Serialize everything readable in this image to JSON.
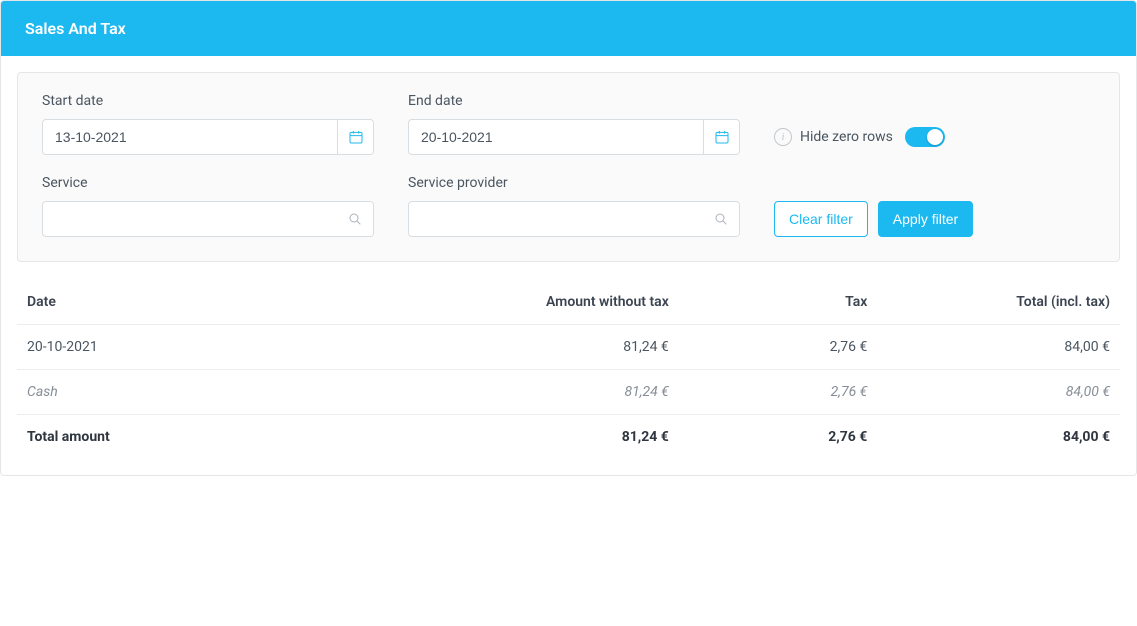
{
  "header": {
    "title": "Sales And Tax"
  },
  "filters": {
    "start_date": {
      "label": "Start date",
      "value": "13-10-2021"
    },
    "end_date": {
      "label": "End date",
      "value": "20-10-2021"
    },
    "service": {
      "label": "Service",
      "value": ""
    },
    "provider": {
      "label": "Service provider",
      "value": ""
    },
    "hide_zero": {
      "label": "Hide zero rows",
      "on": true
    },
    "clear_button": "Clear filter",
    "apply_button": "Apply filter"
  },
  "table": {
    "columns": {
      "date": "Date",
      "amount": "Amount without tax",
      "tax": "Tax",
      "total": "Total (incl. tax)"
    },
    "rows": [
      {
        "type": "main",
        "date": "20-10-2021",
        "amount": "81,24 €",
        "tax": "2,76 €",
        "total": "84,00 €"
      },
      {
        "type": "sub",
        "date": "Cash",
        "amount": "81,24 €",
        "tax": "2,76 €",
        "total": "84,00 €"
      },
      {
        "type": "total",
        "date": "Total amount",
        "amount": "81,24 €",
        "tax": "2,76 €",
        "total": "84,00 €"
      }
    ]
  }
}
